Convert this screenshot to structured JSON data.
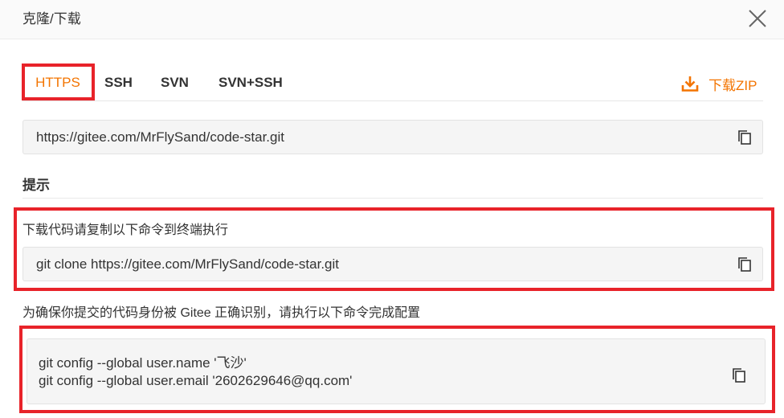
{
  "header": {
    "title": "克隆/下载"
  },
  "tabs": [
    {
      "label": "HTTPS",
      "active": true
    },
    {
      "label": "SSH",
      "active": false
    },
    {
      "label": "SVN",
      "active": false
    },
    {
      "label": "SVN+SSH",
      "active": false
    }
  ],
  "download": {
    "label": "下载ZIP",
    "icon": "download-icon"
  },
  "url": {
    "value": "https://gitee.com/MrFlySand/code-star.git",
    "icon": "copy-icon"
  },
  "hint": {
    "title": "提示",
    "clone_desc": "下载代码请复制以下命令到终端执行",
    "clone_cmd": "git clone https://gitee.com/MrFlySand/code-star.git",
    "config_desc": "为确保你提交的代码身份被 Gitee 正确识别，请执行以下命令完成配置",
    "config_cmd_1": "git config --global user.name '飞沙'",
    "config_cmd_2": "git config --global user.email '2602629646@qq.com'"
  },
  "colors": {
    "accent": "#f37400",
    "highlight": "#e8232a",
    "box_bg": "#f5f5f5"
  }
}
